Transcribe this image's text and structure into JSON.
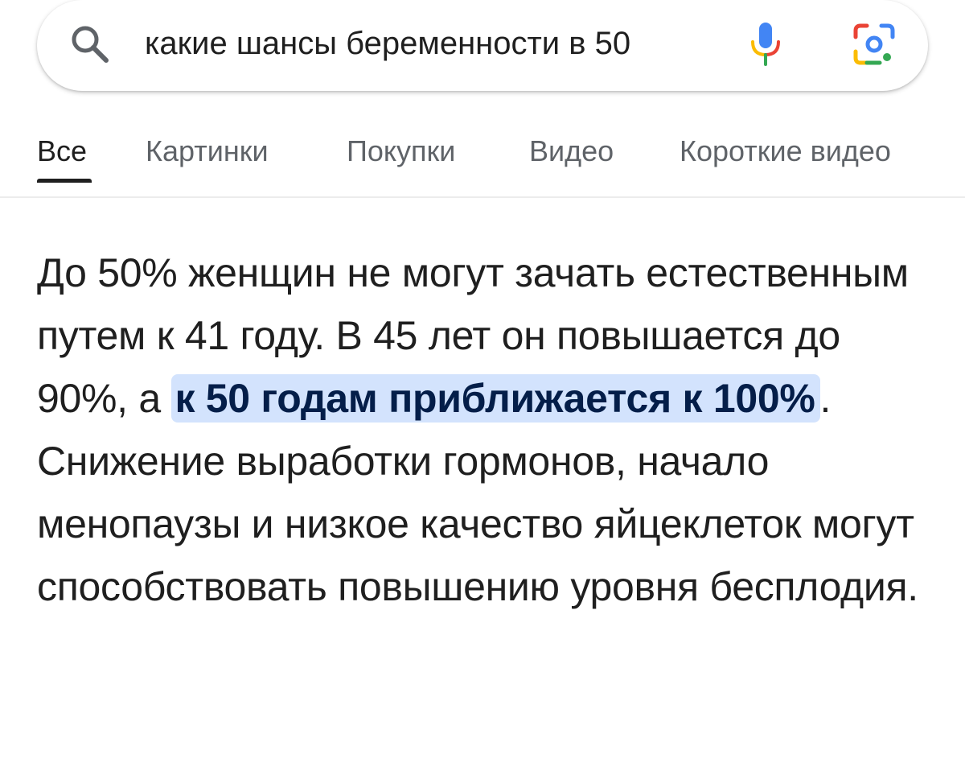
{
  "search": {
    "query": "какие шансы беременности в 50",
    "icons": {
      "search": "search-icon",
      "mic": "mic-icon",
      "lens": "lens-icon"
    }
  },
  "tabs": [
    {
      "label": "Все",
      "active": true
    },
    {
      "label": "Картинки",
      "active": false
    },
    {
      "label": "Покупки",
      "active": false
    },
    {
      "label": "Видео",
      "active": false
    },
    {
      "label": "Короткие видео",
      "active": false
    }
  ],
  "answer": {
    "before": "До 50% женщин не могут зачать естественным путем к 41 году. В 45 лет он повышается до 90%, а ",
    "highlight": "к 50 годам приближается к 100%",
    "after": ". Снижение выработки гормонов, начало менопаузы и низкое качество яйцеклеток могут способствовать повышению уровня бесплодия."
  },
  "colors": {
    "highlight_bg": "#d3e3fd",
    "highlight_text": "#041e49",
    "tab_inactive": "#5f6368",
    "text": "#1f1f1f",
    "google_blue": "#4285f4",
    "google_red": "#ea4335",
    "google_yellow": "#fbbc04",
    "google_green": "#34a853"
  }
}
